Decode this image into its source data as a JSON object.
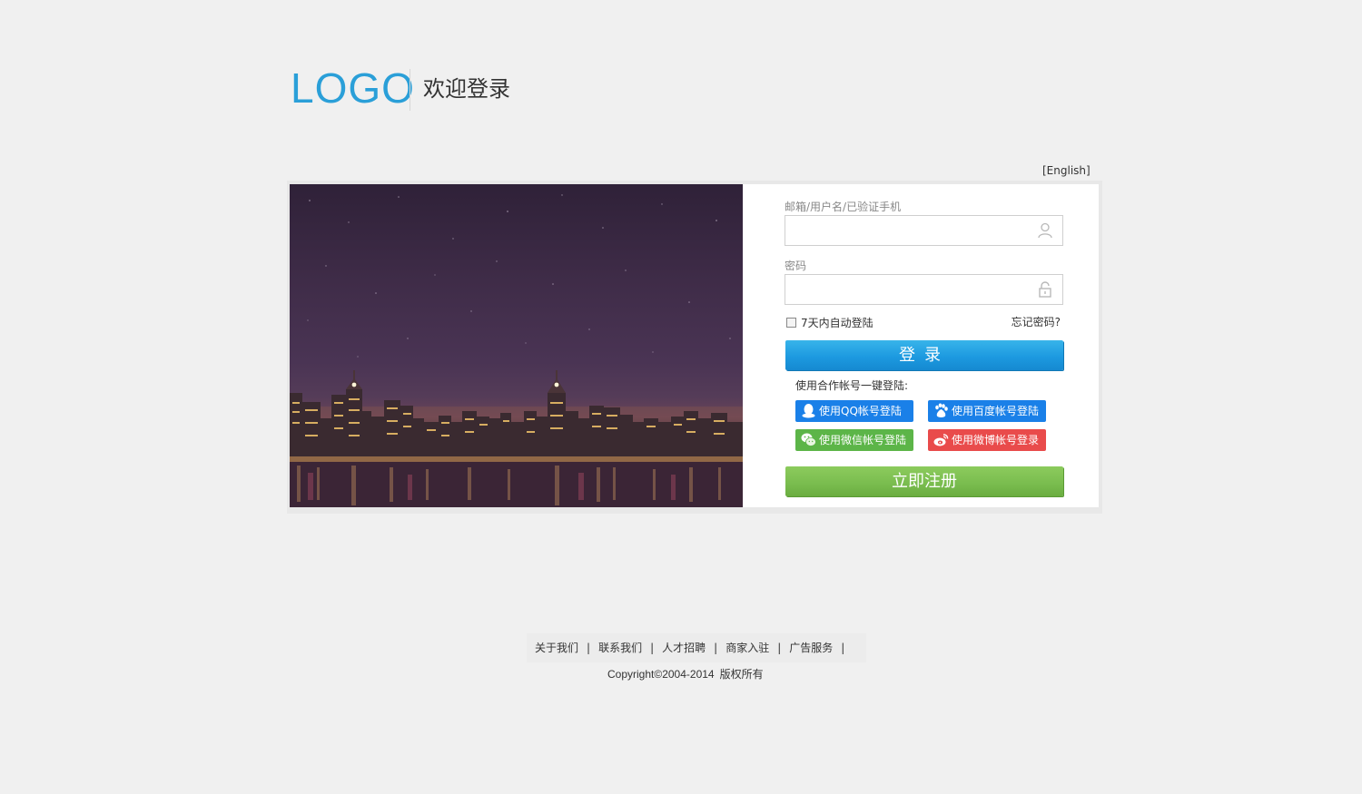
{
  "header": {
    "logo": "LOGO",
    "welcome": "欢迎登录"
  },
  "language_link": "[English]",
  "form": {
    "username_label": "邮箱/用户名/已验证手机",
    "username_value": "",
    "password_label": "密码",
    "password_value": "",
    "remember_label": "7天内自动登陆",
    "remember_checked": false,
    "forgot_label": "忘记密码?",
    "login_button": "登录",
    "partner_title": "使用合作帐号一键登陆:",
    "social": {
      "qq": "使用QQ帐号登陆",
      "baidu": "使用百度帐号登陆",
      "wechat": "使用微信帐号登陆",
      "weibo": "使用微博帐号登录"
    },
    "register_button": "立即注册"
  },
  "footer": {
    "links": [
      "关于我们",
      "联系我们",
      "人才招聘",
      "商家入驻",
      "广告服务"
    ],
    "separator": "|",
    "copyright": "Copyright©2004-2014",
    "rights": "版权所有"
  },
  "colors": {
    "logo": "#2a9fd8",
    "login_button": "#1d9ae0",
    "register_button": "#79bc4e",
    "qq": "#1a80e8",
    "baidu": "#1a80e8",
    "wechat": "#5cb548",
    "weibo": "#e94b4b"
  },
  "icons": [
    "user-icon",
    "lock-icon",
    "qq-icon",
    "baidu-icon",
    "wechat-icon",
    "weibo-icon"
  ]
}
